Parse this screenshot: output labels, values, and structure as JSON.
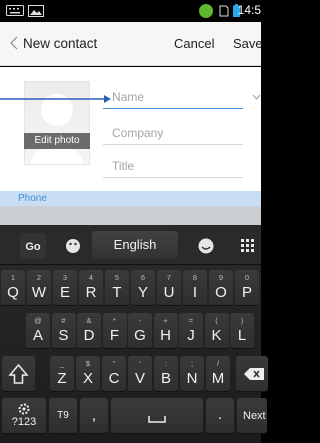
{
  "status_bar": {
    "time": "14:5",
    "icons": [
      "keyboard-icon",
      "image-icon",
      "notification-badge-icon",
      "sim-icon",
      "battery-icon"
    ]
  },
  "action_bar": {
    "title": "New contact",
    "cancel": "Cancel",
    "save": "Save"
  },
  "form": {
    "photo_label": "Edit photo",
    "name_placeholder": "Name",
    "company_placeholder": "Company",
    "title_placeholder": "Title",
    "section": "Phone"
  },
  "keyboard": {
    "language": "English",
    "row1": [
      {
        "main": "Q",
        "sub": "1"
      },
      {
        "main": "W",
        "sub": "2"
      },
      {
        "main": "E",
        "sub": "3"
      },
      {
        "main": "R",
        "sub": "4"
      },
      {
        "main": "T",
        "sub": "5"
      },
      {
        "main": "Y",
        "sub": "6"
      },
      {
        "main": "U",
        "sub": "7"
      },
      {
        "main": "I",
        "sub": "8"
      },
      {
        "main": "O",
        "sub": "9"
      },
      {
        "main": "P",
        "sub": "0"
      }
    ],
    "row2": [
      {
        "main": "A",
        "sub": "@"
      },
      {
        "main": "S",
        "sub": "#"
      },
      {
        "main": "D",
        "sub": "&"
      },
      {
        "main": "F",
        "sub": "*"
      },
      {
        "main": "G",
        "sub": "-"
      },
      {
        "main": "H",
        "sub": "+"
      },
      {
        "main": "J",
        "sub": "="
      },
      {
        "main": "K",
        "sub": "("
      },
      {
        "main": "L",
        "sub": ")"
      }
    ],
    "row3": [
      {
        "main": "Z",
        "sub": "_"
      },
      {
        "main": "X",
        "sub": "$"
      },
      {
        "main": "C",
        "sub": "\""
      },
      {
        "main": "V",
        "sub": "'"
      },
      {
        "main": "B",
        "sub": ":"
      },
      {
        "main": "N",
        "sub": ";"
      },
      {
        "main": "M",
        "sub": "/"
      }
    ],
    "symbols_key": "?123",
    "t9_key": "T9",
    "comma_key": ",",
    "period_key": ".",
    "next_key": "Next"
  }
}
